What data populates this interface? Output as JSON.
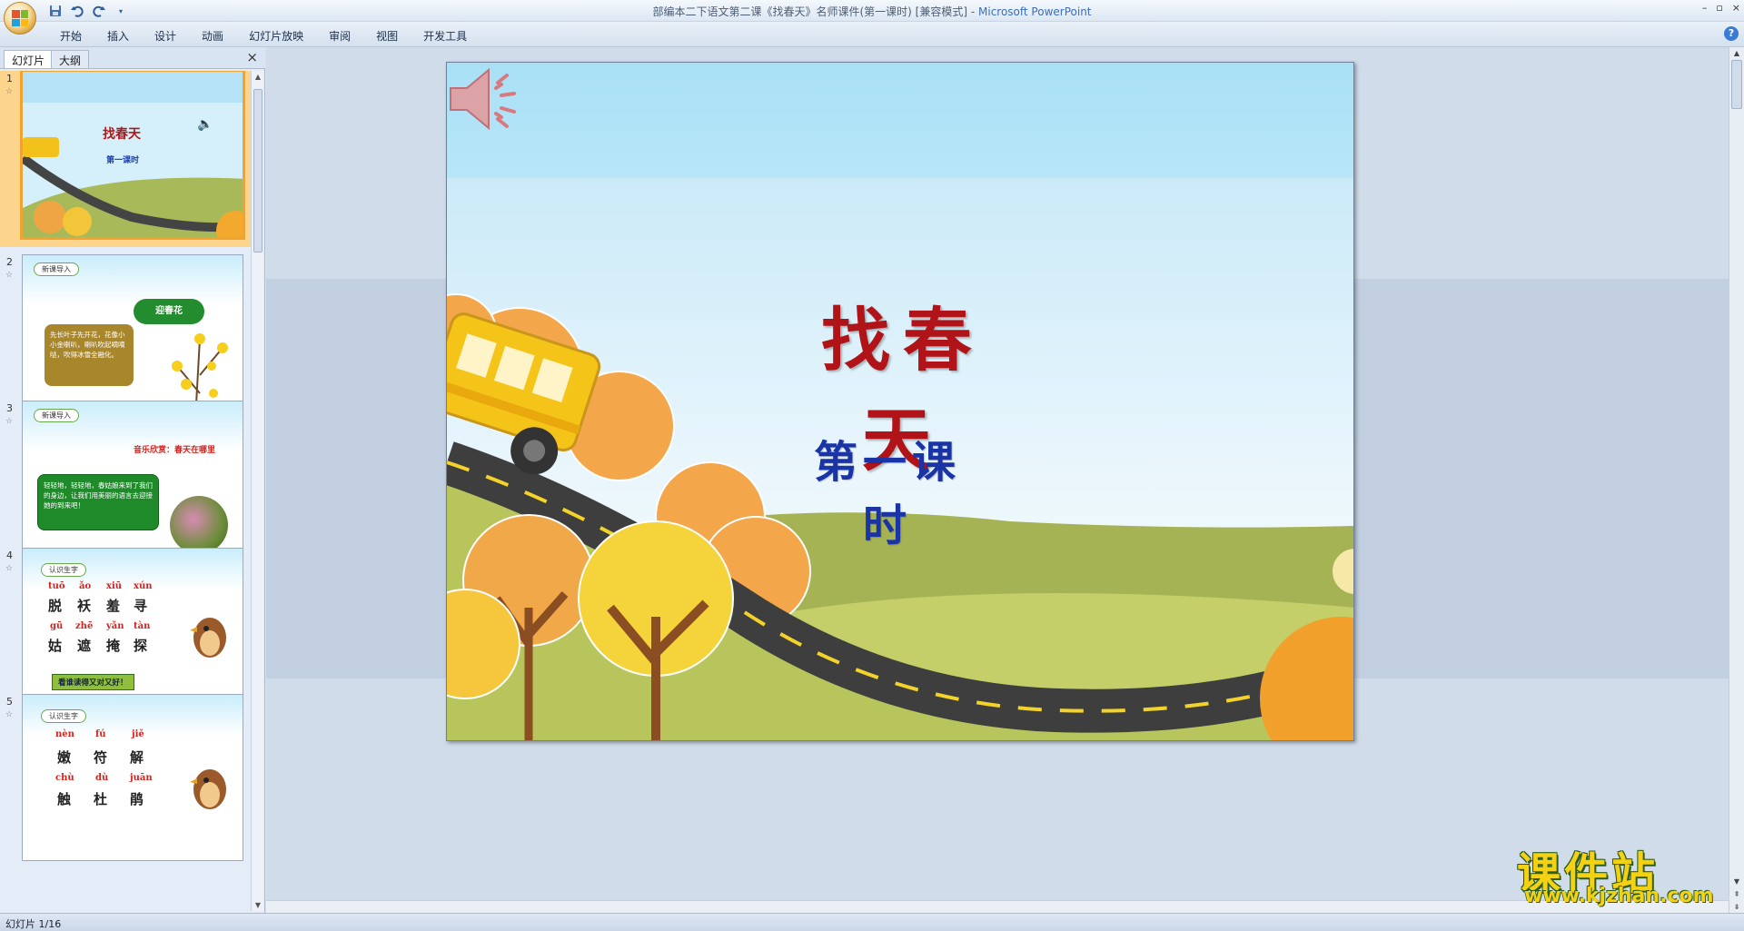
{
  "window": {
    "title": "部编本二下语文第二课《找春天》名师课件(第一课时) [兼容模式] - ",
    "app_name": "Microsoft PowerPoint",
    "controls": [
      "–",
      "▫",
      "×"
    ]
  },
  "quick_access": {
    "icons": [
      "save-icon",
      "undo-icon",
      "redo-icon",
      "customize-icon"
    ]
  },
  "ribbon": {
    "tabs": [
      "开始",
      "插入",
      "设计",
      "动画",
      "幻灯片放映",
      "审阅",
      "视图",
      "开发工具"
    ],
    "help": "?"
  },
  "left_panel": {
    "tab_slides": "幻灯片",
    "tab_outline": "大纲",
    "close": "×"
  },
  "thumbnails": [
    {
      "num": "1",
      "title": "找春天",
      "subtitle": "第一课时",
      "selected": true
    },
    {
      "num": "2",
      "badge": "新课导入",
      "cloud": "迎春花",
      "text": "先长叶子先开花，花像小小金喇叭，喇叭吹起嘀嘀哒，吹得冰雪全融化。"
    },
    {
      "num": "3",
      "badge": "新课导入",
      "heading": "音乐欣赏：春天在哪里",
      "text": "轻轻地，轻轻地，春姑娘来到了我们的身边，让我们用美丽的语言去迎接她的到来吧！"
    },
    {
      "num": "4",
      "badge": "认识生字",
      "pinyin_row1": [
        "tuō",
        "ǎo",
        "xiū",
        "xún"
      ],
      "chars_row1": [
        "脱",
        "袄",
        "羞",
        "寻"
      ],
      "pinyin_row2": [
        "gū",
        "zhē",
        "yǎn",
        "tàn"
      ],
      "chars_row2": [
        "姑",
        "遮",
        "掩",
        "探"
      ],
      "footer": "看谁读得又对又好！"
    },
    {
      "num": "5",
      "badge": "认识生字",
      "pinyin_row1": [
        "nèn",
        "fú",
        "jiě"
      ],
      "chars_row1": [
        "嫩",
        "符",
        "解"
      ],
      "pinyin_row2": [
        "chù",
        "dù",
        "juān"
      ],
      "chars_row2": [
        "触",
        "杜",
        "鹃"
      ]
    }
  ],
  "slide": {
    "title": "找春天",
    "subtitle": "第一课时"
  },
  "status": {
    "text": "幻灯片 1/16"
  },
  "watermark": {
    "title": "课件站",
    "url": "www.kjzhan.com"
  }
}
